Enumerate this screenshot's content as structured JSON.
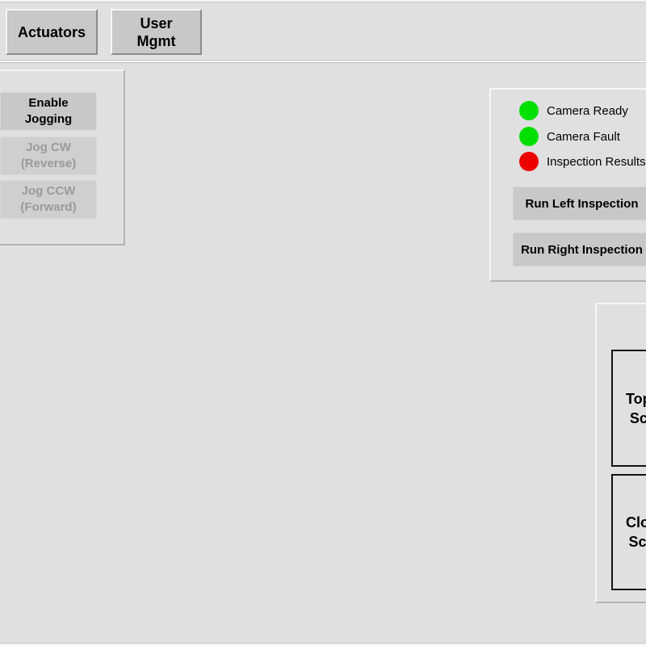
{
  "nav": {
    "actuators_label": "Actuators",
    "user_mgmt_label": "User\nMgmt"
  },
  "jog_panel": {
    "enable_label": "Enable\nJogging",
    "jog_cw_label": "Jog CW\n(Reverse)",
    "jog_ccw_label": "Jog CCW\n(Forward)"
  },
  "inspection_panel": {
    "status": [
      {
        "label": "Camera Ready",
        "color": "#00e000"
      },
      {
        "label": "Camera Fault",
        "color": "#00e000"
      },
      {
        "label": "Inspection Results",
        "color": "#ee0000"
      }
    ],
    "run_left_label": "Run Left Inspection",
    "run_right_label": "Run Right Inspection"
  },
  "screen_panel": {
    "top_screen_label": "Top\nSc",
    "close_screen_label": "Clo\nSc"
  },
  "colors": {
    "background": "#e0e0e0",
    "led_green": "#00e000",
    "led_red": "#ee0000"
  }
}
